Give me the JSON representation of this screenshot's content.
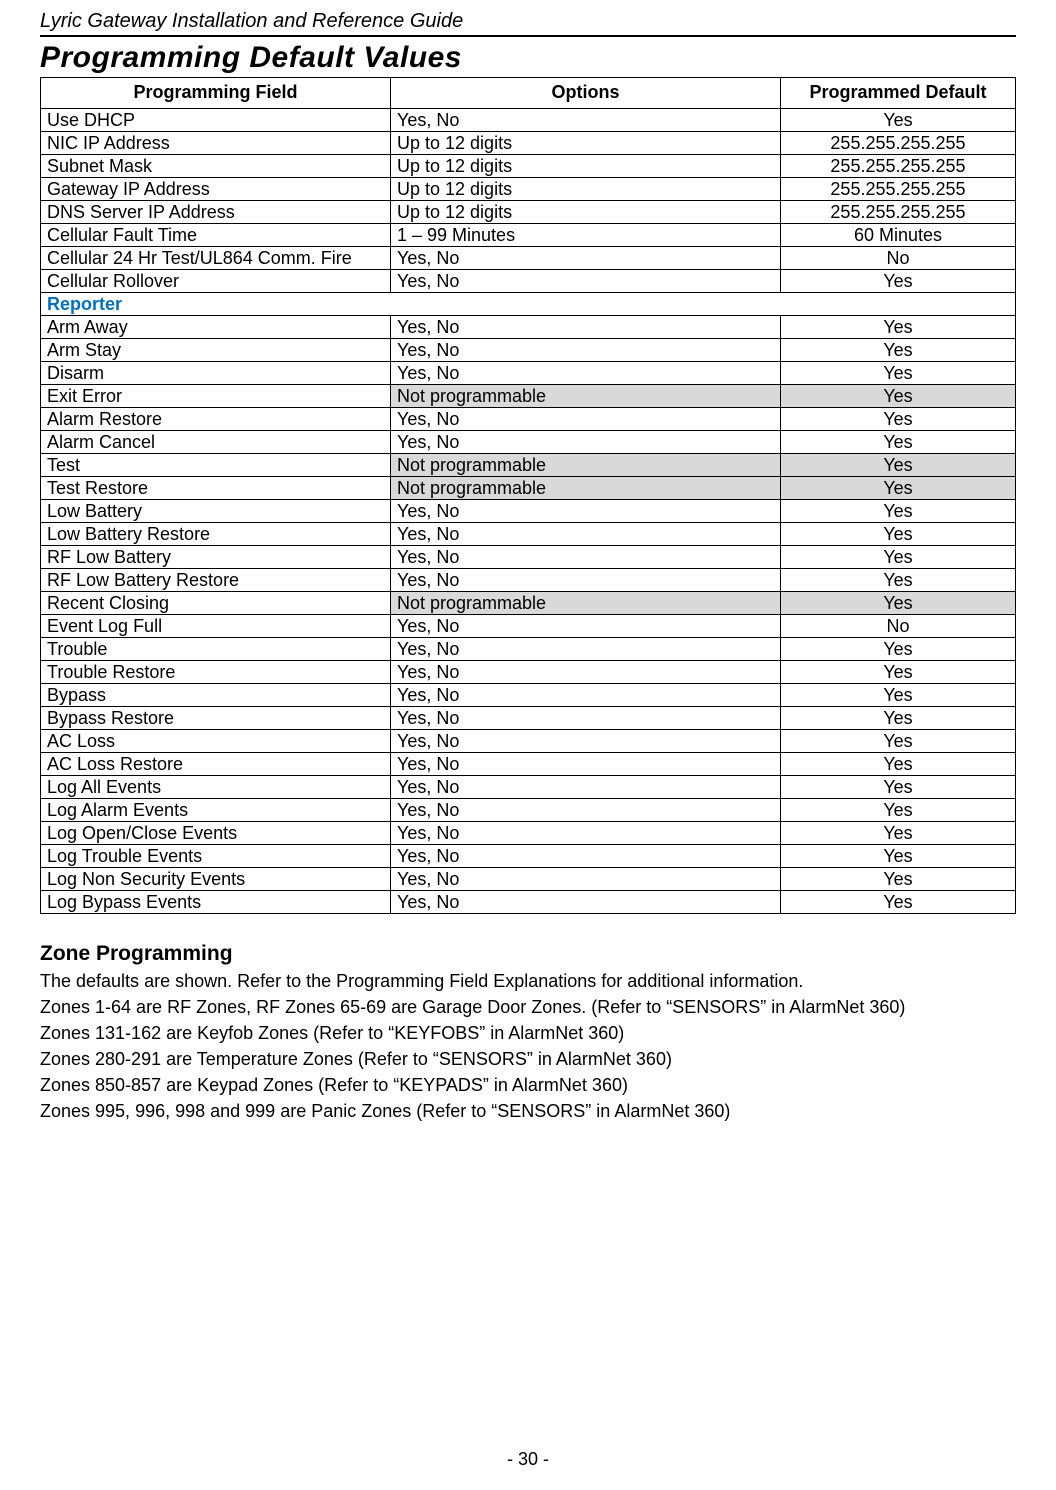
{
  "doc_title": "Lyric Gateway Installation and Reference Guide",
  "section_title": "Programming Default Values",
  "table": {
    "headers": {
      "field": "Programming Field",
      "options": "Options",
      "default": "Programmed Default"
    },
    "rows": [
      {
        "field": "Use DHCP",
        "options": "Yes, No",
        "default": "Yes"
      },
      {
        "field": "NIC IP Address",
        "options": "Up to 12 digits",
        "default": "255.255.255.255"
      },
      {
        "field": "Subnet Mask",
        "options": "Up to 12 digits",
        "default": "255.255.255.255"
      },
      {
        "field": "Gateway IP Address",
        "options": "Up to 12 digits",
        "default": "255.255.255.255"
      },
      {
        "field": "DNS Server IP Address",
        "options": "Up to 12 digits",
        "default": "255.255.255.255"
      },
      {
        "field": "Cellular Fault Time",
        "options": "1 – 99 Minutes",
        "default": "60 Minutes"
      },
      {
        "field": "Cellular 24 Hr Test/UL864 Comm. Fire",
        "options": "Yes, No",
        "default": "No"
      },
      {
        "field": "Cellular Rollover",
        "options": "Yes, No",
        "default": "Yes"
      },
      {
        "section": "Reporter"
      },
      {
        "field": "Arm Away",
        "options": "Yes, No",
        "default": "Yes"
      },
      {
        "field": "Arm Stay",
        "options": "Yes, No",
        "default": "Yes"
      },
      {
        "field": "Disarm",
        "options": "Yes, No",
        "default": "Yes"
      },
      {
        "field": "Exit Error",
        "options": "Not programmable",
        "default": "Yes",
        "shaded": true
      },
      {
        "field": "Alarm Restore",
        "options": "Yes, No",
        "default": "Yes"
      },
      {
        "field": "Alarm Cancel",
        "options": "Yes, No",
        "default": "Yes"
      },
      {
        "field": "Test",
        "options": "Not programmable",
        "default": "Yes",
        "shaded": true
      },
      {
        "field": "Test Restore",
        "options": "Not programmable",
        "default": "Yes",
        "shaded": true
      },
      {
        "field": "Low Battery",
        "options": "Yes, No",
        "default": "Yes"
      },
      {
        "field": "Low Battery Restore",
        "options": "Yes, No",
        "default": "Yes"
      },
      {
        "field": "RF Low Battery",
        "options": "Yes, No",
        "default": "Yes"
      },
      {
        "field": "RF Low Battery Restore",
        "options": "Yes, No",
        "default": "Yes"
      },
      {
        "field": "Recent Closing",
        "options": "Not programmable",
        "default": "Yes",
        "shaded": true
      },
      {
        "field": "Event Log Full",
        "options": "Yes, No",
        "default": "No"
      },
      {
        "field": "Trouble",
        "options": "Yes, No",
        "default": "Yes"
      },
      {
        "field": "Trouble Restore",
        "options": "Yes, No",
        "default": "Yes"
      },
      {
        "field": "Bypass",
        "options": "Yes, No",
        "default": "Yes"
      },
      {
        "field": "Bypass Restore",
        "options": "Yes, No",
        "default": "Yes"
      },
      {
        "field": "AC Loss",
        "options": "Yes, No",
        "default": "Yes"
      },
      {
        "field": "AC Loss Restore",
        "options": "Yes, No",
        "default": "Yes"
      },
      {
        "field": "Log All Events",
        "options": "Yes, No",
        "default": "Yes"
      },
      {
        "field": "Log Alarm Events",
        "options": "Yes, No",
        "default": "Yes"
      },
      {
        "field": "Log Open/Close Events",
        "options": "Yes, No",
        "default": "Yes"
      },
      {
        "field": "Log Trouble Events",
        "options": "Yes, No",
        "default": "Yes"
      },
      {
        "field": "Log Non Security Events",
        "options": "Yes, No",
        "default": "Yes"
      },
      {
        "field": "Log Bypass Events",
        "options": "Yes, No",
        "default": "Yes"
      }
    ]
  },
  "zone": {
    "heading": "Zone Programming",
    "lines": [
      "The defaults are shown.  Refer to the Programming Field Explanations for additional information.",
      "Zones 1-64 are RF Zones, RF Zones 65-69 are Garage Door Zones. (Refer to \"SENSORS\" in AlarmNet 360)",
      "Zones 131-162 are Keyfob Zones (Refer to \"KEYFOBS\" in AlarmNet 360)",
      "Zones 280-291 are Temperature Zones (Refer to \"SENSORS\" in AlarmNet 360)",
      "Zones 850-857 are Keypad Zones (Refer to \"KEYPADS\" in AlarmNet 360)",
      "Zones 995, 996, 998 and 999 are Panic Zones (Refer to \"SENSORS\" in AlarmNet 360)"
    ]
  },
  "page_number": "- 30 -"
}
